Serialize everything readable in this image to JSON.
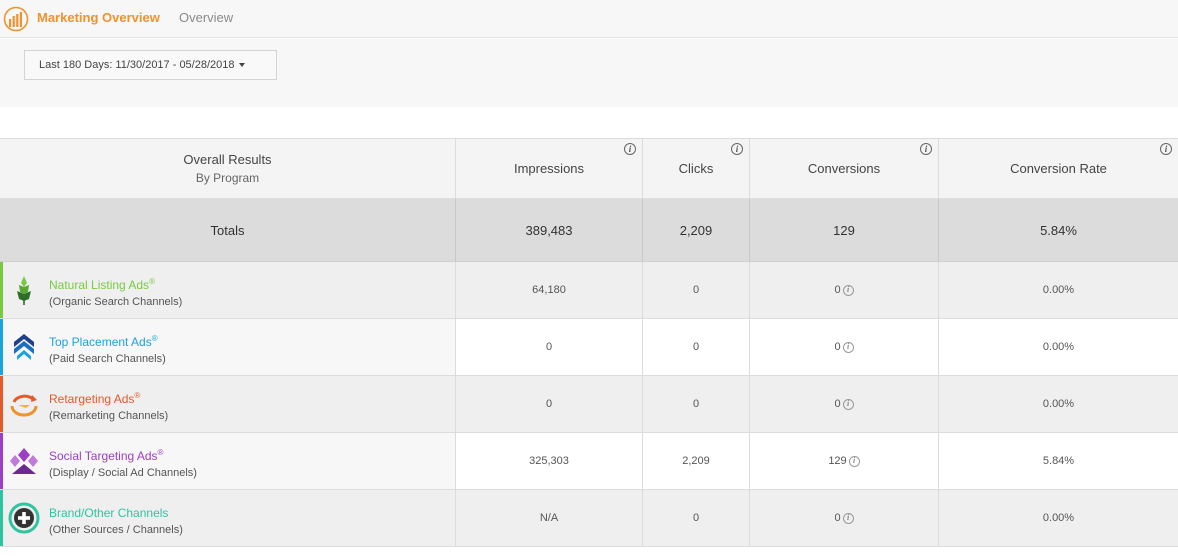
{
  "header": {
    "app_title": "Marketing Overview",
    "page_subtitle": "Overview",
    "accent_color": "#f0922d"
  },
  "filters": {
    "date_range_label": "Last 180 Days: 11/30/2017 - 05/28/2018"
  },
  "table": {
    "first_col_title": "Overall Results",
    "first_col_subtitle": "By Program",
    "columns": [
      "Impressions",
      "Clicks",
      "Conversions",
      "Conversion Rate"
    ],
    "totals": {
      "label": "Totals",
      "impressions": "389,483",
      "clicks": "2,209",
      "conversions": "129",
      "conversion_rate": "5.84%"
    },
    "programs": [
      {
        "name": "Natural Listing Ads",
        "mark": "®",
        "desc": "(Organic Search Channels)",
        "color": "#7ac943",
        "icon": "leaf-icon",
        "impressions": "64,180",
        "clicks": "0",
        "conversions": "0",
        "conversion_rate": "0.00%"
      },
      {
        "name": "Top Placement Ads",
        "mark": "®",
        "desc": "(Paid Search Channels)",
        "color": "#1aa3dd",
        "icon": "chevron-stack-icon",
        "impressions": "0",
        "clicks": "0",
        "conversions": "0",
        "conversion_rate": "0.00%"
      },
      {
        "name": "Retargeting Ads",
        "mark": "®",
        "desc": "(Remarketing Channels)",
        "color": "#e35b2a",
        "icon": "retarget-arrow-icon",
        "impressions": "0",
        "clicks": "0",
        "conversions": "0",
        "conversion_rate": "0.00%"
      },
      {
        "name": "Social Targeting Ads",
        "mark": "®",
        "desc": "(Display / Social Ad Channels)",
        "color": "#9b3fc4",
        "icon": "social-people-icon",
        "impressions": "325,303",
        "clicks": "2,209",
        "conversions": "129",
        "conversion_rate": "5.84%"
      },
      {
        "name": "Brand/Other Channels",
        "mark": "",
        "desc": "(Other Sources / Channels)",
        "color": "#2ec4a0",
        "icon": "plus-circle-icon",
        "impressions": "N/A",
        "clicks": "0",
        "conversions": "0",
        "conversion_rate": "0.00%"
      }
    ]
  }
}
